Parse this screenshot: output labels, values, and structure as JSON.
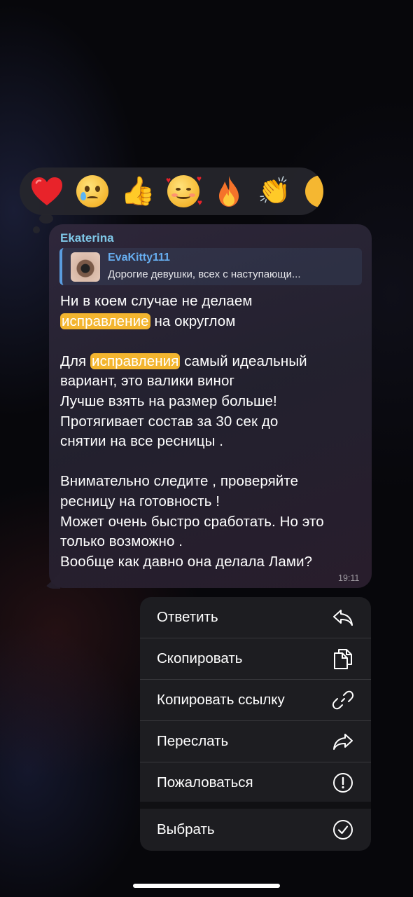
{
  "reactions": [
    "heart",
    "crying-face",
    "thumbs-up",
    "smiling-face-with-hearts",
    "fire",
    "clapping-hands",
    "grinning-face"
  ],
  "message": {
    "sender": "Ekaterina",
    "reply": {
      "author": "EvaKitty111",
      "text": "Дорогие девушки, всех с наступающи..."
    },
    "lines": [
      {
        "before": "Ни в коем случае не делаем",
        "highlight": "",
        "after": ""
      },
      {
        "before": "",
        "highlight": "исправление",
        "after": " на округлом"
      },
      {
        "before": "",
        "highlight": "",
        "after": ""
      },
      {
        "before": "Для ",
        "highlight": "исправления",
        "after": " самый идеальный"
      },
      {
        "before": "вариант, это валики виног",
        "highlight": "",
        "after": ""
      },
      {
        "before": "Лучше взять на размер больше!",
        "highlight": "",
        "after": ""
      },
      {
        "before": "Протягивает состав за 30 сек до",
        "highlight": "",
        "after": ""
      },
      {
        "before": "снятии на все ресницы .",
        "highlight": "",
        "after": ""
      },
      {
        "before": "",
        "highlight": "",
        "after": ""
      },
      {
        "before": "Внимательно следите , проверяйте",
        "highlight": "",
        "after": ""
      },
      {
        "before": "ресницу на готовность !",
        "highlight": "",
        "after": ""
      },
      {
        "before": "Может очень быстро сработать. Но это",
        "highlight": "",
        "after": ""
      },
      {
        "before": "только возможно .",
        "highlight": "",
        "after": ""
      },
      {
        "before": "Вообще как давно она делала Лами?",
        "highlight": "",
        "after": ""
      }
    ],
    "time": "19:11",
    "highlight_color": "#f3b52f"
  },
  "menu": {
    "reply": "Ответить",
    "copy": "Скопировать",
    "copy_link": "Копировать ссылку",
    "forward": "Переслать",
    "report": "Пожаловаться",
    "select": "Выбрать"
  },
  "colors": {
    "sender": "#7fc8e8",
    "reply_author": "#67aef0",
    "reply_bar": "#5a9de0"
  }
}
